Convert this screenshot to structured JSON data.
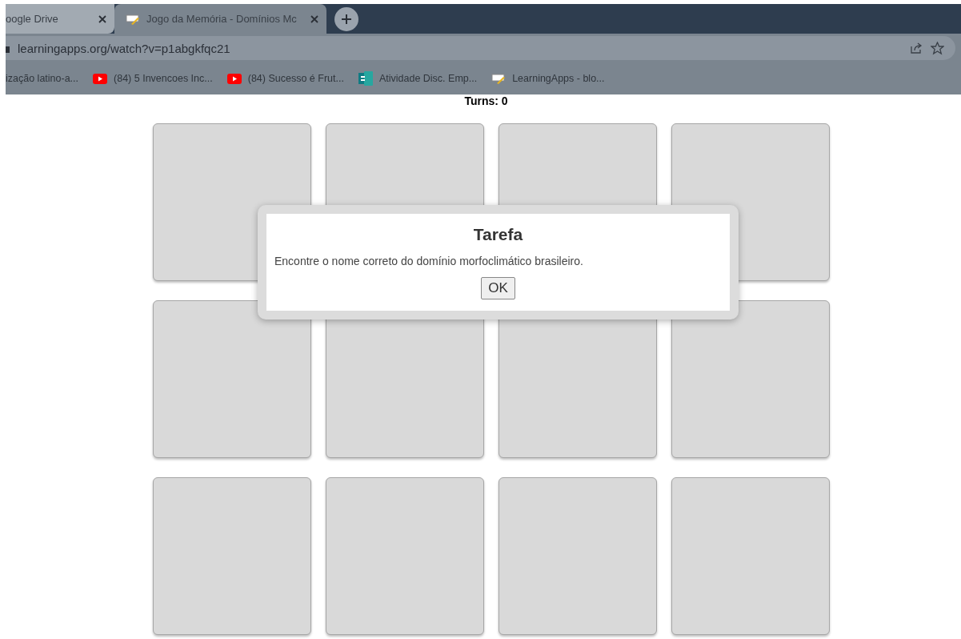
{
  "browser": {
    "tabs": [
      {
        "label": "oogle Drive",
        "selected": false,
        "kind": "none"
      },
      {
        "label": "Jogo da Memória - Domínios Mc",
        "selected": true,
        "kind": "notepad"
      }
    ],
    "address": "learningapps.org/watch?v=p1abgkfqc21",
    "bookmarks": [
      {
        "label": "ização latino-a...",
        "kind": "none"
      },
      {
        "label": "(84) 5 Invencoes Inc...",
        "kind": "video"
      },
      {
        "label": "(84) Sucesso é Frut...",
        "kind": "video"
      },
      {
        "label": "Atividade Disc. Emp...",
        "kind": "forms"
      },
      {
        "label": "LearningApps - blo...",
        "kind": "notepad"
      }
    ]
  },
  "game": {
    "turns": "Turns: 0",
    "cards": [
      {
        "revealed": false
      },
      {
        "revealed": false
      },
      {
        "revealed": false
      },
      {
        "revealed": false
      },
      {
        "revealed": false
      },
      {
        "revealed": false
      },
      {
        "revealed": false
      },
      {
        "revealed": false
      },
      {
        "revealed": false
      },
      {
        "revealed": false
      },
      {
        "revealed": false
      },
      {
        "revealed": false
      }
    ]
  },
  "dialog": {
    "title": "Tarefa",
    "message": "Encontre o nome correto do domínio morfoclimático brasileiro.",
    "button": "OK"
  }
}
